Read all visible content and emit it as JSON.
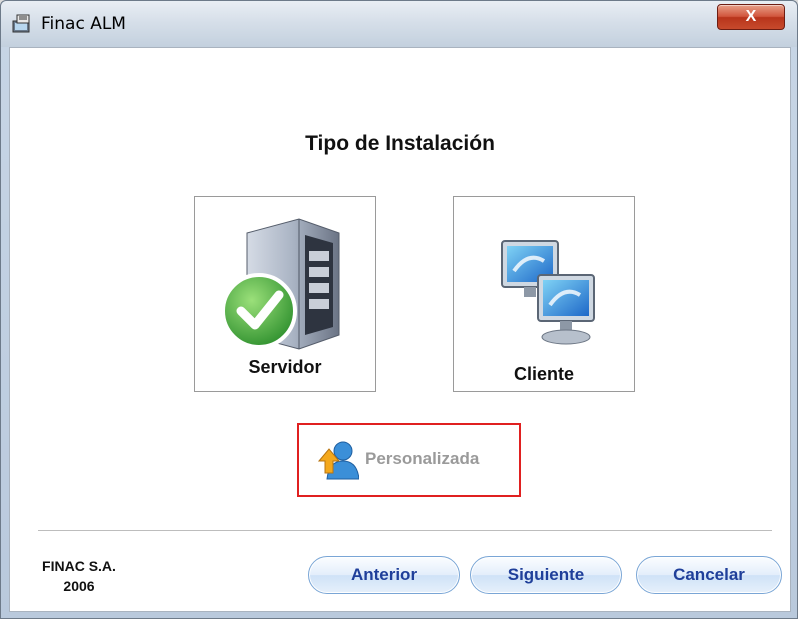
{
  "window": {
    "title": "Finac ALM",
    "close_label": "X"
  },
  "main": {
    "heading": "Tipo de Instalación",
    "options": {
      "server": "Servidor",
      "client": "Cliente",
      "custom": "Personalizada"
    }
  },
  "footer": {
    "company_line1": "FINAC S.A.",
    "company_line2": "2006",
    "buttons": {
      "previous": "Anterior",
      "next": "Siguiente",
      "cancel": "Cancelar"
    }
  },
  "colors": {
    "highlight": "#e02020",
    "button_text": "#1f3f9a",
    "check_green": "#3cab3c"
  },
  "icons": {
    "app": "installer-icon",
    "server": "server-check-icon",
    "client": "network-computers-icon",
    "custom": "user-arrow-icon"
  }
}
